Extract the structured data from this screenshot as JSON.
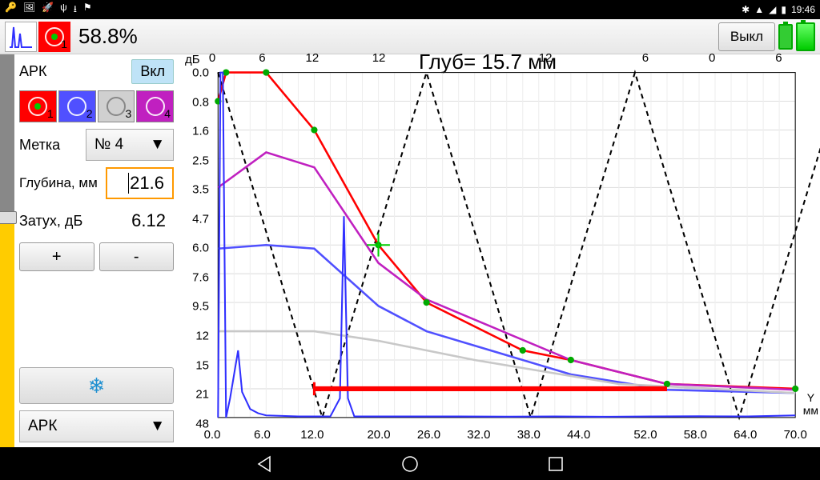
{
  "status": {
    "time": "19:46"
  },
  "topbar": {
    "percent": "58.8%",
    "off_label": "Выкл"
  },
  "panel": {
    "title": "АРК",
    "on_label": "Вкл",
    "channels": [
      "1",
      "2",
      "3",
      "4"
    ],
    "marker_label": "Метка",
    "marker_value": "№ 4",
    "depth_label": "Глубина, мм",
    "depth_value": "21.6",
    "atten_label": "Затух, дБ",
    "atten_value": "6.12",
    "plus": "+",
    "minus": "-",
    "mode_select": "АРК"
  },
  "chart_data": {
    "type": "line",
    "title": "Глуб= 15.7 мм",
    "xlabel": "мм",
    "ylabel": "дБ",
    "xlim": [
      0,
      72
    ],
    "ylim_db": [
      0,
      48
    ],
    "y_ticks": [
      "0.0",
      "0.8",
      "1.6",
      "2.5",
      "3.5",
      "4.7",
      "6.0",
      "7.6",
      "9.5",
      "12",
      "15",
      "21",
      "48"
    ],
    "x_ticks": [
      "0.0",
      "6.0",
      "12.0",
      "20.0",
      "26.0",
      "32.0",
      "38.0",
      "44.0",
      "52.0",
      "58.0",
      "64.0",
      "70.0"
    ],
    "top_scale": [
      "0",
      "6",
      "12",
      "12",
      "12",
      "6",
      "0",
      "6"
    ],
    "depth_readout_mm": 15.7,
    "crosshair": {
      "x_mm": 20.0,
      "y_db": 6.0
    },
    "gate_bar": {
      "start_mm": 12.0,
      "end_mm": 56.0,
      "y_db": 21
    },
    "series": [
      {
        "name": "red",
        "color": "#ff0000",
        "x": [
          0,
          1,
          6,
          12,
          20,
          26,
          38,
          44,
          56,
          72
        ],
        "y_db": [
          0.8,
          0.0,
          0.0,
          1.6,
          6.0,
          9.5,
          14,
          15,
          20,
          21
        ]
      },
      {
        "name": "magenta",
        "color": "#c020c0",
        "x": [
          0,
          6,
          12,
          20,
          26,
          44,
          56,
          72
        ],
        "y_db": [
          3.5,
          2.3,
          2.8,
          7.0,
          9.3,
          15,
          20,
          22
        ]
      },
      {
        "name": "blue-curve",
        "color": "#5050ff",
        "x": [
          0,
          6,
          12,
          20,
          26,
          44,
          56,
          72
        ],
        "y_db": [
          6.2,
          6.0,
          6.2,
          9.8,
          12,
          18,
          22,
          25
        ]
      },
      {
        "name": "gray",
        "color": "#c8c8c8",
        "x": [
          0,
          6,
          12,
          20,
          32,
          50,
          72
        ],
        "y_db": [
          12,
          12,
          12,
          13,
          15,
          20,
          25
        ]
      }
    ],
    "signal": {
      "name": "a-scan",
      "color": "#3030ff",
      "x": [
        0,
        0.3,
        0.6,
        1.0,
        1.5,
        2.5,
        3.0,
        4.0,
        5.0,
        6.0,
        8,
        10,
        12,
        14,
        15.2,
        15.7,
        16.2,
        17,
        18,
        20,
        24,
        30,
        36,
        42,
        48,
        54,
        60,
        66,
        72
      ],
      "y_db": [
        48,
        0.0,
        0.0,
        48,
        30,
        14,
        24,
        40,
        44,
        46,
        46.5,
        47,
        47,
        47,
        30,
        4.7,
        30,
        47,
        47,
        47,
        47,
        47,
        47.2,
        47,
        47.3,
        47,
        46.8,
        47,
        46
      ]
    },
    "vpath": {
      "color": "#000",
      "x": [
        0,
        13,
        26,
        39,
        52,
        65,
        78
      ],
      "y_db": [
        0,
        48,
        0,
        48,
        0,
        48,
        0
      ]
    }
  }
}
